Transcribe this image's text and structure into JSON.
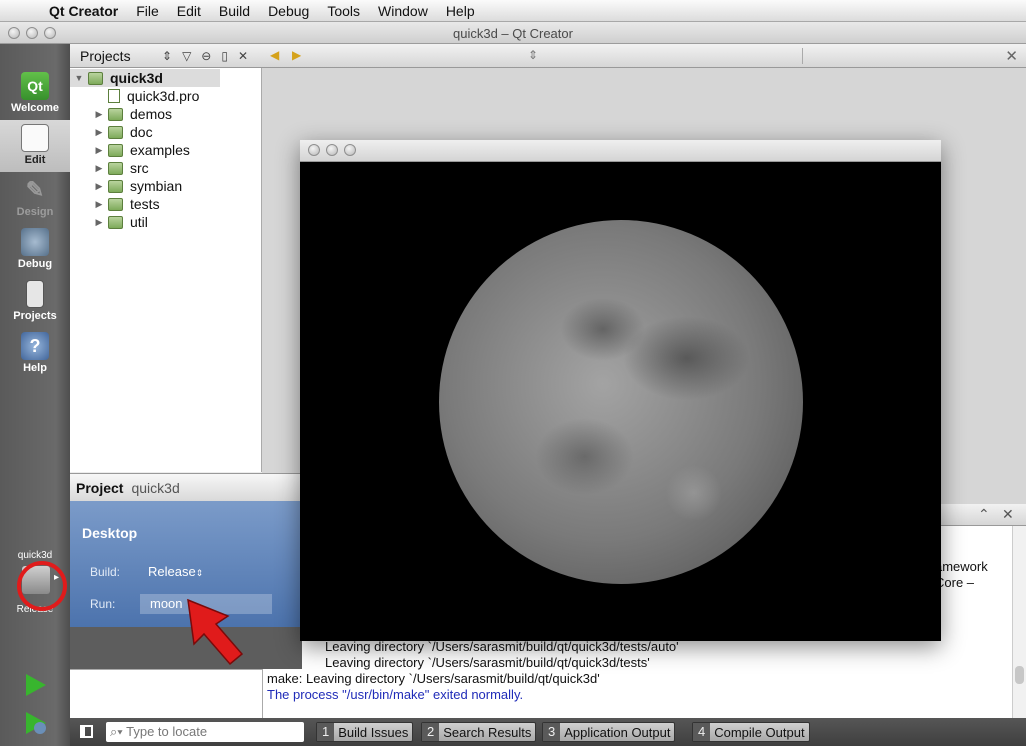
{
  "menubar": {
    "app_name": "Qt Creator",
    "items": [
      "File",
      "Edit",
      "Build",
      "Debug",
      "Tools",
      "Window",
      "Help"
    ]
  },
  "window": {
    "title": "quick3d – Qt Creator"
  },
  "modes": {
    "welcome": "Welcome",
    "edit": "Edit",
    "design": "Design",
    "debug": "Debug",
    "projects": "Projects",
    "help": "Help",
    "qt_logo": "Qt"
  },
  "target_selector": {
    "project": "quick3d",
    "config": "Release"
  },
  "projects_pane": {
    "title": "Projects",
    "tree": {
      "root": "quick3d",
      "pro_file": "quick3d.pro",
      "folders": [
        "demos",
        "doc",
        "examples",
        "src",
        "symbian",
        "tests",
        "util"
      ]
    }
  },
  "project_popup": {
    "header_label": "Project",
    "header_value": "quick3d",
    "kit": "Desktop",
    "build_label": "Build:",
    "build_value": "Release",
    "run_label": "Run:",
    "run_value": "moon"
  },
  "output": {
    "lines": [
      "amework",
      "Core –",
      "Leaving directory `/Users/sarasmit/build/qt/quick3d/tests/auto'",
      "Leaving directory `/Users/sarasmit/build/qt/quick3d/tests'",
      "make: Leaving directory `/Users/sarasmit/build/qt/quick3d'",
      "The process \"/usr/bin/make\" exited normally."
    ]
  },
  "statusbar": {
    "locator_placeholder": "Type to locate",
    "tabs": [
      {
        "num": "1",
        "label": "Build Issues"
      },
      {
        "num": "2",
        "label": "Search Results"
      },
      {
        "num": "3",
        "label": "Application Output"
      },
      {
        "num": "4",
        "label": "Compile Output"
      }
    ]
  },
  "icons": {
    "apple": "apple-logo-icon",
    "run": "play-icon",
    "debug_run": "debug-play-icon",
    "build": "hammer-icon"
  },
  "colors": {
    "run_green": "#38b52e",
    "annotation_red": "#e01b1b",
    "output_info_blue": "#1f2bb8",
    "popup_blue": "#4c73ad"
  }
}
